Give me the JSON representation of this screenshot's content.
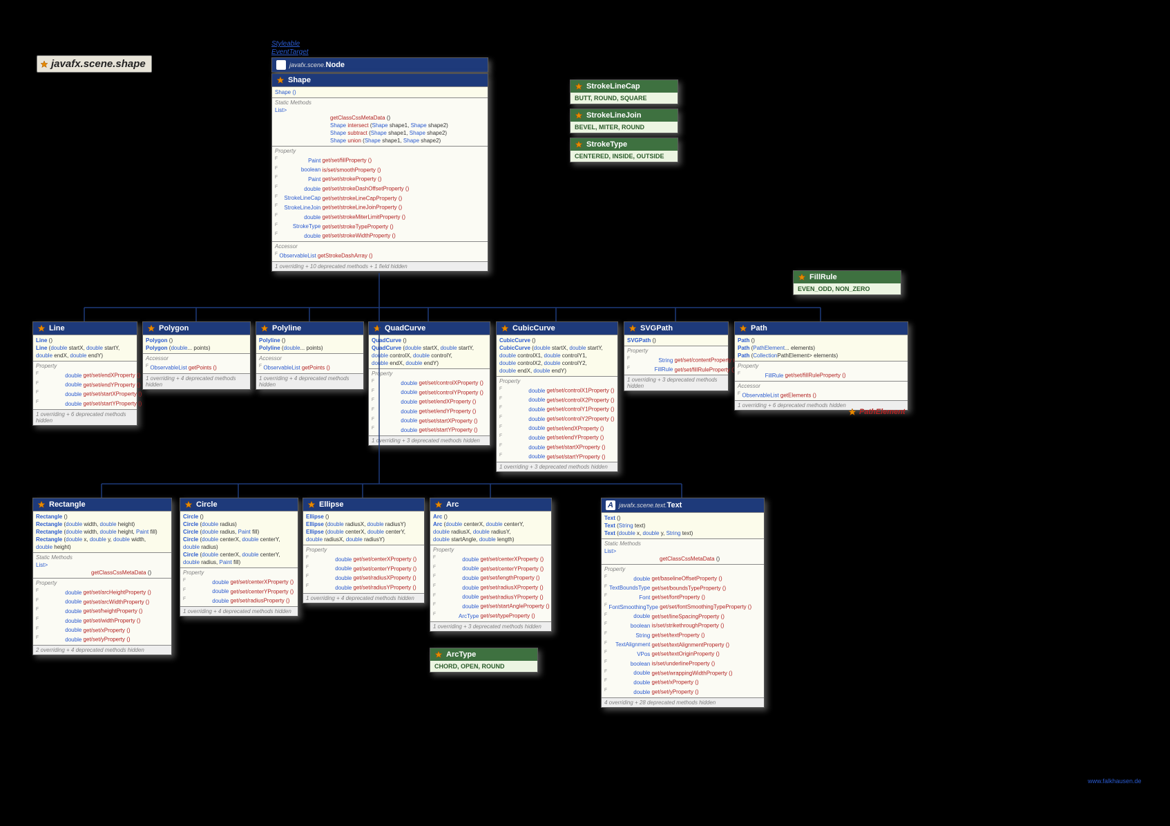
{
  "package": "javafx.scene.shape",
  "interfaces": [
    "Styleable",
    "EventTarget"
  ],
  "node": {
    "pkg": "javafx.scene.",
    "name": "Node"
  },
  "shape": {
    "name": "Shape",
    "constructors": [
      "Shape ()"
    ],
    "staticLabel": "Static Methods",
    "statics": [
      {
        "ret": "List<CssMetaData<? extends Styleable, ?>>",
        "name": "",
        "sig": ""
      },
      {
        "ret": "",
        "name": "getClassCssMetaData",
        "sig": " ()"
      },
      {
        "ret": "Shape",
        "name": "intersect",
        "sig": " (Shape shape1, Shape shape2)"
      },
      {
        "ret": "Shape",
        "name": "subtract",
        "sig": " (Shape shape1, Shape shape2)"
      },
      {
        "ret": "Shape",
        "name": "union",
        "sig": " (Shape shape1, Shape shape2)"
      }
    ],
    "propLabel": "Property",
    "props": [
      {
        "t": "Paint",
        "m": "get/set/fillProperty ()"
      },
      {
        "t": "boolean",
        "m": "is/set/smoothProperty ()"
      },
      {
        "t": "Paint",
        "m": "get/set/strokeProperty ()"
      },
      {
        "t": "double",
        "m": "get/set/strokeDashOffsetProperty ()"
      },
      {
        "t": "StrokeLineCap",
        "m": "get/set/strokeLineCapProperty ()"
      },
      {
        "t": "StrokeLineJoin",
        "m": "get/set/strokeLineJoinProperty ()"
      },
      {
        "t": "double",
        "m": "get/set/strokeMiterLimitProperty ()"
      },
      {
        "t": "StrokeType",
        "m": "get/set/strokeTypeProperty ()"
      },
      {
        "t": "double",
        "m": "get/set/strokeWidthProperty ()"
      }
    ],
    "accessorLabel": "Accessor",
    "accessors": [
      {
        "t": "ObservableList<Double>",
        "m": "getStrokeDashArray ()"
      }
    ],
    "hint": "1 overriding + 10 deprecated methods + 1 field hidden"
  },
  "enums": {
    "StrokeLineCap": "BUTT, ROUND, SQUARE",
    "StrokeLineJoin": "BEVEL, MITER, ROUND",
    "StrokeType": "CENTERED, INSIDE, OUTSIDE",
    "FillRule": "EVEN_ODD, NON_ZERO",
    "ArcType": "CHORD, OPEN, ROUND"
  },
  "children": {
    "Line": {
      "cons": [
        "Line ()",
        "Line (double startX, double startY,",
        "        double endX, double endY)"
      ],
      "props": [
        {
          "t": "double",
          "m": "get/set/endXProperty ()"
        },
        {
          "t": "double",
          "m": "get/set/endYProperty ()"
        },
        {
          "t": "double",
          "m": "get/set/startXProperty ()"
        },
        {
          "t": "double",
          "m": "get/set/startYProperty ()"
        }
      ],
      "hint": "1 overriding + 6 deprecated methods hidden"
    },
    "Polygon": {
      "cons": [
        "Polygon ()",
        "Polygon (double... points)"
      ],
      "acc": [
        {
          "t": "ObservableList<Double>",
          "m": "getPoints ()"
        }
      ],
      "hint": "1 overriding + 4 deprecated methods hidden"
    },
    "Polyline": {
      "cons": [
        "Polyline ()",
        "Polyline (double... points)"
      ],
      "acc": [
        {
          "t": "ObservableList<Double>",
          "m": "getPoints ()"
        }
      ],
      "hint": "1 overriding + 4 deprecated methods hidden"
    },
    "QuadCurve": {
      "cons": [
        "QuadCurve ()",
        "QuadCurve (double startX, double startY,",
        "        double controlX, double controlY,",
        "        double endX, double endY)"
      ],
      "props": [
        {
          "t": "double",
          "m": "get/set/controlXProperty ()"
        },
        {
          "t": "double",
          "m": "get/set/controlYProperty ()"
        },
        {
          "t": "double",
          "m": "get/set/endXProperty ()"
        },
        {
          "t": "double",
          "m": "get/set/endYProperty ()"
        },
        {
          "t": "double",
          "m": "get/set/startXProperty ()"
        },
        {
          "t": "double",
          "m": "get/set/startYProperty ()"
        }
      ],
      "hint": "1 overriding + 3 deprecated methods hidden"
    },
    "CubicCurve": {
      "cons": [
        "CubicCurve ()",
        "CubicCurve (double startX, double startY,",
        "        double controlX1, double controlY1,",
        "        double controlX2, double controlY2,",
        "        double endX, double endY)"
      ],
      "props": [
        {
          "t": "double",
          "m": "get/set/controlX1Property ()"
        },
        {
          "t": "double",
          "m": "get/set/controlX2Property ()"
        },
        {
          "t": "double",
          "m": "get/set/controlY1Property ()"
        },
        {
          "t": "double",
          "m": "get/set/controlY2Property ()"
        },
        {
          "t": "double",
          "m": "get/set/endXProperty ()"
        },
        {
          "t": "double",
          "m": "get/set/endYProperty ()"
        },
        {
          "t": "double",
          "m": "get/set/startXProperty ()"
        },
        {
          "t": "double",
          "m": "get/set/startYProperty ()"
        }
      ],
      "hint": "1 overriding + 3 deprecated methods hidden"
    },
    "SVGPath": {
      "cons": [
        "SVGPath ()"
      ],
      "props": [
        {
          "t": "String",
          "m": "get/set/contentProperty ()"
        },
        {
          "t": "FillRule",
          "m": "get/set/fillRuleProperty ()"
        }
      ],
      "hint": "1 overriding + 3 deprecated methods hidden"
    },
    "Path": {
      "cons": [
        "Path ()",
        "Path (PathElement... elements)",
        "Path (Collection<? extends PathElement> elements)"
      ],
      "props": [
        {
          "t": "FillRule",
          "m": "get/set/fillRuleProperty ()"
        }
      ],
      "acc": [
        {
          "t": "ObservableList<PathElement>",
          "m": "getElements ()"
        }
      ],
      "hint": "1 overriding + 6 deprecated methods hidden"
    },
    "Rectangle": {
      "cons": [
        "Rectangle ()",
        "Rectangle (double width, double height)",
        "Rectangle (double width, double height, Paint fill)",
        "Rectangle (double x, double y, double width,",
        "        double height)"
      ],
      "staticLabel": "Static Methods",
      "statics": [
        {
          "ret": "List<CssMetaData<? extends Styleable, ?>>",
          "name": "",
          "sig": ""
        },
        {
          "ret": "",
          "name": "getClassCssMetaData",
          "sig": " ()"
        }
      ],
      "props": [
        {
          "t": "double",
          "m": "get/set/arcHeightProperty ()"
        },
        {
          "t": "double",
          "m": "get/set/arcWidthProperty ()"
        },
        {
          "t": "double",
          "m": "get/set/heightProperty ()"
        },
        {
          "t": "double",
          "m": "get/set/widthProperty ()"
        },
        {
          "t": "double",
          "m": "get/set/xProperty ()"
        },
        {
          "t": "double",
          "m": "get/set/yProperty ()"
        }
      ],
      "hint": "2 overriding + 4 deprecated methods hidden"
    },
    "Circle": {
      "cons": [
        "Circle ()",
        "Circle (double radius)",
        "Circle (double radius, Paint fill)",
        "Circle (double centerX, double centerY,",
        "        double radius)",
        "Circle (double centerX, double centerY,",
        "        double radius, Paint fill)"
      ],
      "props": [
        {
          "t": "double",
          "m": "get/set/centerXProperty ()"
        },
        {
          "t": "double",
          "m": "get/set/centerYProperty ()"
        },
        {
          "t": "double",
          "m": "get/set/radiusProperty ()"
        }
      ],
      "hint": "1 overriding + 4 deprecated methods hidden"
    },
    "Ellipse": {
      "cons": [
        "Ellipse ()",
        "Ellipse (double radiusX, double radiusY)",
        "Ellipse (double centerX, double centerY,",
        "        double radiusX, double radiusY)"
      ],
      "props": [
        {
          "t": "double",
          "m": "get/set/centerXProperty ()"
        },
        {
          "t": "double",
          "m": "get/set/centerYProperty ()"
        },
        {
          "t": "double",
          "m": "get/set/radiusXProperty ()"
        },
        {
          "t": "double",
          "m": "get/set/radiusYProperty ()"
        }
      ],
      "hint": "1 overriding + 4 deprecated methods hidden"
    },
    "Arc": {
      "cons": [
        "Arc ()",
        "Arc (double centerX, double centerY,",
        "        double radiusX, double radiusY,",
        "        double startAngle, double length)"
      ],
      "props": [
        {
          "t": "double",
          "m": "get/set/centerXProperty ()"
        },
        {
          "t": "double",
          "m": "get/set/centerYProperty ()"
        },
        {
          "t": "double",
          "m": "get/set/lengthProperty ()"
        },
        {
          "t": "double",
          "m": "get/set/radiusXProperty ()"
        },
        {
          "t": "double",
          "m": "get/set/radiusYProperty ()"
        },
        {
          "t": "double",
          "m": "get/set/startAngleProperty ()"
        },
        {
          "t": "ArcType",
          "m": "get/set/typeProperty ()"
        }
      ],
      "hint": "1 overriding + 3 deprecated methods hidden"
    },
    "Text": {
      "pkg": "javafx.scene.text.",
      "cons": [
        "Text ()",
        "Text (String text)",
        "Text (double x, double y, String text)"
      ],
      "staticLabel": "Static Methods",
      "statics": [
        {
          "ret": "List<CssMetaData<? extends Styleable, ?>>",
          "name": "",
          "sig": ""
        },
        {
          "ret": "",
          "name": "getClassCssMetaData",
          "sig": " ()"
        }
      ],
      "props": [
        {
          "t": "double",
          "m": "get/baselineOffsetProperty ()"
        },
        {
          "t": "TextBoundsType",
          "m": "get/set/boundsTypeProperty ()"
        },
        {
          "t": "Font",
          "m": "get/set/fontProperty ()"
        },
        {
          "t": "FontSmoothingType",
          "m": "get/set/fontSmoothingTypeProperty ()"
        },
        {
          "t": "double",
          "m": "get/set/lineSpacingProperty ()"
        },
        {
          "t": "boolean",
          "m": "is/set/strikethroughProperty ()"
        },
        {
          "t": "String",
          "m": "get/set/textProperty ()"
        },
        {
          "t": "TextAlignment",
          "m": "get/set/textAlignmentProperty ()"
        },
        {
          "t": "VPos",
          "m": "get/set/textOriginProperty ()"
        },
        {
          "t": "boolean",
          "m": "is/set/underlineProperty ()"
        },
        {
          "t": "double",
          "m": "get/set/wrappingWidthProperty ()"
        },
        {
          "t": "double",
          "m": "get/set/xProperty ()"
        },
        {
          "t": "double",
          "m": "get/set/yProperty ()"
        }
      ],
      "hint": "4 overriding + 28 deprecated methods hidden"
    }
  },
  "pathElement": "PathElement",
  "watermark": "www.falkhausen.de",
  "labels": {
    "property": "Property",
    "accessor": "Accessor"
  }
}
